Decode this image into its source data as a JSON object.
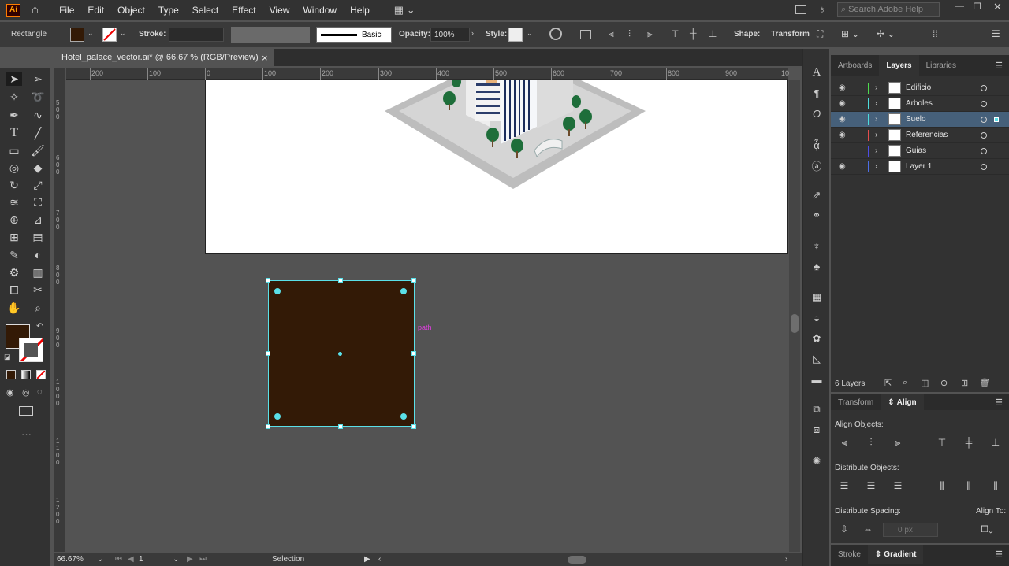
{
  "app": {
    "logo": "Ai"
  },
  "menu": [
    "File",
    "Edit",
    "Object",
    "Type",
    "Select",
    "Effect",
    "View",
    "Window",
    "Help"
  ],
  "search": {
    "placeholder": "Search Adobe Help"
  },
  "control": {
    "tool_name": "Rectangle",
    "stroke_label": "Stroke:",
    "stroke_profile": "Basic",
    "opacity_label": "Opacity:",
    "opacity_value": "100%",
    "style_label": "Style:",
    "shape_label": "Shape:",
    "transform_label": "Transform",
    "fill_color": "#331a06"
  },
  "document": {
    "tab_title": "Hotel_palace_vector.ai* @ 66.67 % (RGB/Preview)",
    "close": "×"
  },
  "rulers": {
    "h": [
      "200",
      "100",
      "0",
      "100",
      "200",
      "300",
      "400",
      "500",
      "600",
      "700",
      "800",
      "900",
      "10"
    ],
    "v": [
      "5\n0\n0",
      "6\n0\n0",
      "7\n0\n0",
      "8\n0\n0",
      "9\n0\n0",
      "1\n0\n0\n0",
      "1\n1\n0\n0",
      "1\n2\n0\n0"
    ]
  },
  "canvas": {
    "hover_label": "path",
    "rect_color": "#331a06",
    "selection_color": "#5ae0e8"
  },
  "panels": {
    "tabs_top": [
      "Artboards",
      "Layers",
      "Libraries"
    ],
    "active_top": "Layers",
    "layers": [
      {
        "name": "Edificio",
        "color": "#4ddc4d",
        "visible": true
      },
      {
        "name": "Arboles",
        "color": "#4ddcdc",
        "visible": true
      },
      {
        "name": "Suelo",
        "color": "#4ddcdc",
        "visible": true,
        "selected": true
      },
      {
        "name": "Referencias",
        "color": "#e64d4d",
        "visible": true
      },
      {
        "name": "Guias",
        "color": "#4d4de6",
        "visible": false
      },
      {
        "name": "Layer 1",
        "color": "#4d6ee6",
        "visible": true
      }
    ],
    "layer_count": "6 Layers",
    "tabs_mid": [
      "Transform",
      "Align"
    ],
    "align_objects": "Align Objects:",
    "distribute_objects": "Distribute Objects:",
    "distribute_spacing": "Distribute Spacing:",
    "align_to": "Align To:",
    "spacing_value": "0 px",
    "tabs_bottom": [
      "Stroke",
      "Gradient"
    ]
  },
  "status": {
    "zoom": "66.67%",
    "artboard": "1",
    "tool": "Selection"
  }
}
